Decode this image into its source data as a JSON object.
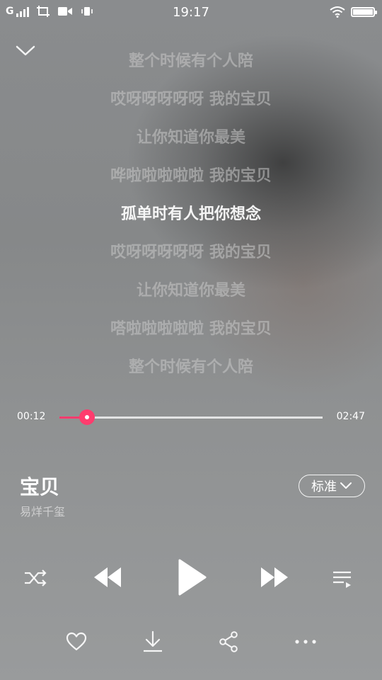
{
  "status_bar": {
    "carrier": "G",
    "time": "19:17"
  },
  "lyrics": [
    {
      "text": "整个时候有个人陪",
      "current": false
    },
    {
      "text": "哎呀呀呀呀呀 我的宝贝",
      "current": false
    },
    {
      "text": "让你知道你最美",
      "current": false
    },
    {
      "text": "哗啦啦啦啦啦 我的宝贝",
      "current": false
    },
    {
      "text": "孤单时有人把你想念",
      "current": true
    },
    {
      "text": "哎呀呀呀呀呀 我的宝贝",
      "current": false
    },
    {
      "text": "让你知道你最美",
      "current": false
    },
    {
      "text": "嗒啦啦啦啦啦 我的宝贝",
      "current": false
    },
    {
      "text": "整个时候有个人陪",
      "current": false
    }
  ],
  "playback": {
    "elapsed": "00:12",
    "total": "02:47",
    "progress": 0.105
  },
  "song": {
    "title": "宝贝",
    "artist": "易烊千玺",
    "quality_label": "标准"
  },
  "colors": {
    "accent": "#ff3c6e"
  },
  "icons": {
    "collapse": "chevron-down-icon",
    "shuffle": "shuffle-icon",
    "previous": "previous-icon",
    "play": "play-icon",
    "next": "next-icon",
    "playlist": "playlist-icon",
    "favorite": "heart-icon",
    "download": "download-icon",
    "share": "share-icon",
    "more": "more-icon"
  }
}
